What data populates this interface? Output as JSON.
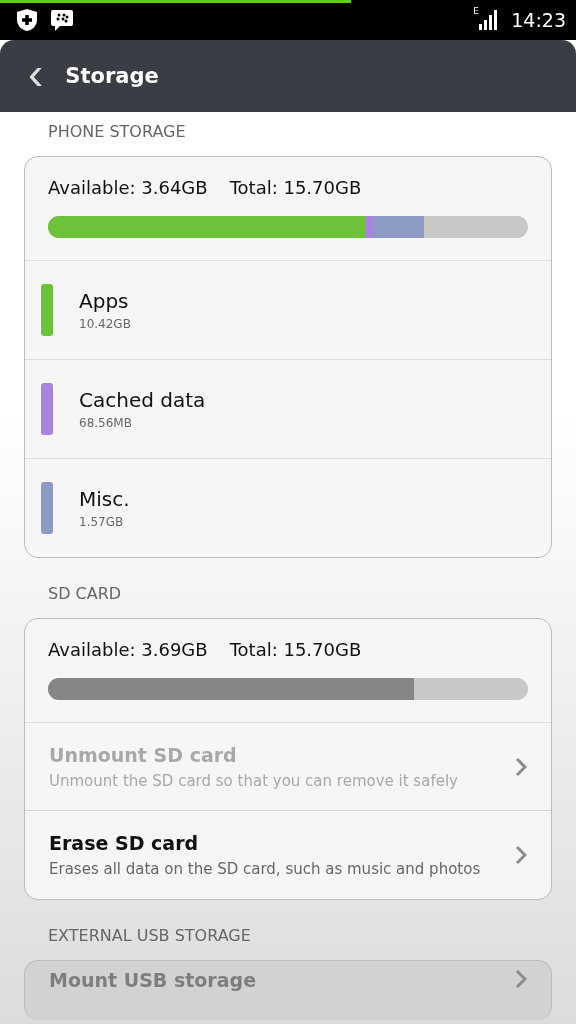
{
  "status_bar": {
    "time": "14:23",
    "network": "E",
    "download_progress": {
      "level": 0.61
    }
  },
  "header": {
    "back": "‹",
    "title": "Storage"
  },
  "phone_storage": {
    "heading": "PHONE STORAGE",
    "available": "Available: 3.64GB",
    "total": "Total: 15.70GB",
    "segments": [
      {
        "name": "Apps",
        "size": "10.42GB",
        "color": "#6cc33a",
        "level": 0.662
      },
      {
        "name": "Cached data",
        "size": "68.56MB",
        "color": "#a883e0"
      },
      {
        "name": "Misc.",
        "size": "1.57GB",
        "color": "#8d9bc4"
      }
    ]
  },
  "sd_card": {
    "heading": "SD CARD",
    "available": "Available: 3.69GB",
    "total": "Total: 15.70GB",
    "used": {
      "level": 0.762
    },
    "actions": [
      {
        "title": "Unmount SD card",
        "subtitle": "Unmount the SD card so that you can remove it safely",
        "disabled": true
      },
      {
        "title": "Erase SD card",
        "subtitle": "Erases all data on the SD card, such as music and photos",
        "disabled": false
      }
    ]
  },
  "external_usb": {
    "heading": "EXTERNAL USB STORAGE",
    "actions": [
      {
        "title": "Mount USB storage",
        "disabled": true
      }
    ]
  }
}
